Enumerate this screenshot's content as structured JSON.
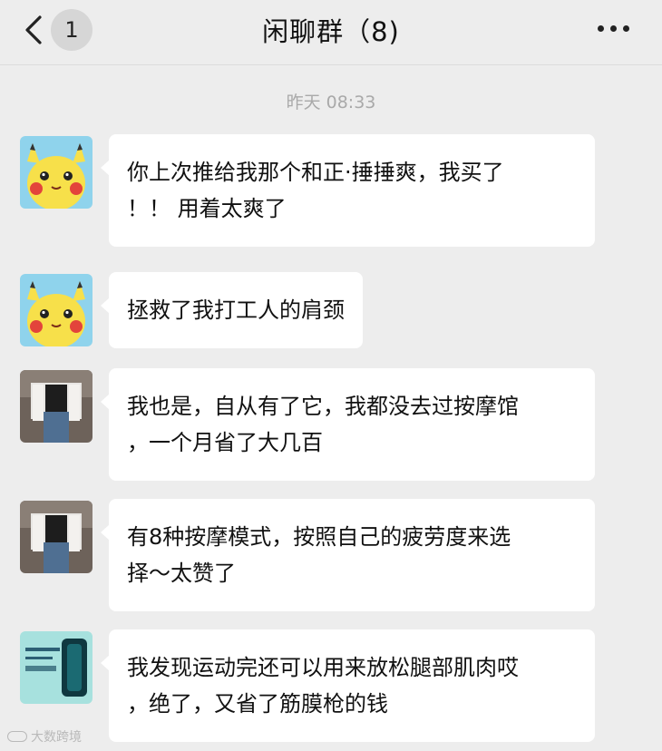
{
  "header": {
    "unread_count": "1",
    "title": "闲聊群（8)",
    "back_icon": "chevron-left-icon",
    "more_icon": "more-dots-icon"
  },
  "timestamp": "昨天 08:33",
  "messages": [
    {
      "avatar": "pikachu-avatar",
      "lines": [
        "你上次推给我那个和正·捶捶爽，我买了",
        "！！ 用着太爽了"
      ]
    },
    {
      "avatar": "pikachu-avatar",
      "lines": [
        "拯救了我打工人的肩颈"
      ]
    },
    {
      "avatar": "woman-photo-avatar",
      "lines": [
        "我也是，自从有了它，我都没去过按摩馆",
        "，一个月省了大几百"
      ]
    },
    {
      "avatar": "woman-photo-avatar",
      "lines": [
        "有8种按摩模式，按照自己的疲劳度来选",
        "择～太赞了"
      ]
    },
    {
      "avatar": "product-image-avatar",
      "lines": [
        "我发现运动完还可以用来放松腿部肌肉哎",
        "，绝了，又省了筋膜枪的钱"
      ]
    }
  ],
  "watermark": "大数跨境",
  "colors": {
    "background": "#ededed",
    "bubble": "#ffffff",
    "timestamp": "#a9a9a9"
  }
}
